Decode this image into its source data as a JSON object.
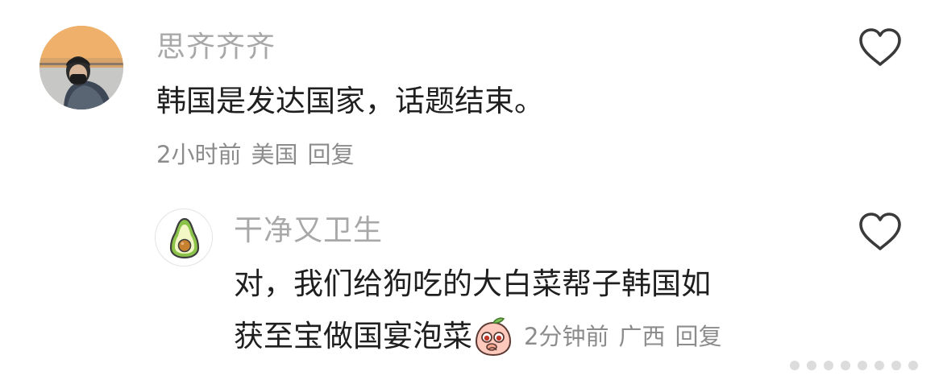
{
  "comment": {
    "username": "思齐齐齐",
    "text": "韩国是发达国家，话题结束。",
    "time": "2小时前",
    "location": "美国",
    "reply_label": "回复",
    "avatar": "person-photo-sunset",
    "like_icon": "heart-outline-icon"
  },
  "reply": {
    "username": "干净又卫生",
    "text_line1": "对，我们给狗吃的大白菜帮子韩国如",
    "text_line2": "获至宝做国宴泡菜",
    "emoji": "peach-face-emoji",
    "time": "2分钟前",
    "location": "广西",
    "reply_label": "回复",
    "avatar": "avocado-icon",
    "like_icon": "heart-outline-icon"
  },
  "colors": {
    "username": "#a8a8a8",
    "text": "#1f1f1f",
    "meta": "#8c8c8c",
    "avocado_skin": "#8bc34a",
    "avocado_flesh": "#f3f7c5",
    "avocado_pit": "#c6802f"
  }
}
